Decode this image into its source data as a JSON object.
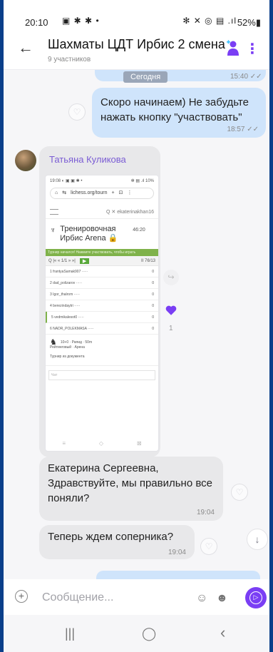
{
  "status_bar": {
    "time": "20:10",
    "left_icons": "▣ ✱ ✱ •",
    "right_icons": "✻ ✕ ◎ ▤ .ıl",
    "battery": "52%▮"
  },
  "header": {
    "back_icon": "←",
    "title": "Шахматы ЦДТ Ирбис 2 смена",
    "subtitle": "9 участников",
    "more_icon": "⋮"
  },
  "chat": {
    "date_label": "Сегодня",
    "prev_time": "15:40 ✓✓",
    "messages": [
      {
        "direction": "outgoing",
        "text_line1": "Скоро начинаем) Не забудьте",
        "text_line2": "нажать кнопку \"участвовать\"",
        "time": "18:57 ✓✓"
      },
      {
        "direction": "incoming",
        "sender": "Татьяна Куликова",
        "type": "image"
      },
      {
        "direction": "incoming",
        "text": "Екатерина Сергеевна, Здравствуйте, мы правильно все поняли?",
        "time": "19:04"
      },
      {
        "direction": "incoming",
        "text": "Теперь ждем соперника?",
        "time": "19:04"
      }
    ],
    "reaction_count": "1"
  },
  "screenshot": {
    "status": "19:08 ◐ ▣ ▣ ✱ •",
    "status_right": "✻ ▤ .ıl 10%",
    "home": "⌂",
    "url": "lichess.org/tourn",
    "url_icon": "⇆",
    "plus": "+",
    "tabs": "⊡",
    "menu": "⋮",
    "search": "Q",
    "close": "✕",
    "user": "ekaterinakhan16",
    "trophy": "♆",
    "tournament": "Тренировочная Ирбис Arena 🔒",
    "tournament_time": "46:20",
    "banner": "Турнир начался! Нажмите участвовать, чтобы играть",
    "pager": "Q  |« « 1/1 » »|",
    "join": "▶",
    "pager_right": "II 76/13",
    "rows": [
      "1  frantyaSamak907 ·····",
      "2  dad_polizarov ·····",
      "3  Igor_thalrom ·····",
      "4  berezindaytri ·····",
      "5  vedmikalesot0 ·····",
      "6  NADR_POLEKMASA ·····"
    ],
    "row_values": [
      "0",
      "0",
      "0",
      "0",
      "0",
      "0"
    ],
    "knight": "♞",
    "info_line1": "10+0 · Рапид · 50m",
    "info_line2": "Рейтинговый · Арена",
    "info_line3": "Турнир из документа",
    "chat_placeholder": "Чат",
    "s_nav": [
      "≡",
      "◇",
      "⊠"
    ]
  },
  "composer": {
    "placeholder": "Сообщение...",
    "plus_icon": "+",
    "emoji_icon": "☺",
    "sticker_icon": "☻",
    "send_icon": "▷"
  },
  "nav": {
    "recent": "|||",
    "home": "◯",
    "back": "‹"
  },
  "colors": {
    "accent": "#7a3ef4",
    "outgoing_bubble": "#cfe4fb",
    "incoming_bubble": "#e8e8ea",
    "sender_name": "#7a5cd4"
  }
}
